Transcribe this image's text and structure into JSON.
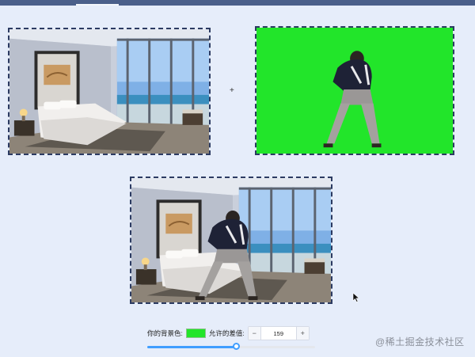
{
  "canvas": {
    "operator_symbol": "+",
    "images": [
      {
        "role": "background",
        "description": "bedroom-photo"
      },
      {
        "role": "foreground",
        "description": "person-on-green-screen"
      },
      {
        "role": "composite",
        "description": "person-composited-into-bedroom"
      }
    ]
  },
  "controls": {
    "bg_color_label": "你的背景色:",
    "bg_color_value": "#22e52a",
    "tolerance_label": "允许的差值:",
    "tolerance_value": "159",
    "minus_label": "−",
    "plus_label": "+",
    "slider_value": 0.53
  },
  "watermark": {
    "text": "@稀土掘金技术社区"
  },
  "colors": {
    "page_bg": "#e6edfa",
    "topbar": "#4a5f8a",
    "frame_border": "#2c3b62",
    "accent": "#409eff",
    "green_screen": "#22e52a"
  }
}
